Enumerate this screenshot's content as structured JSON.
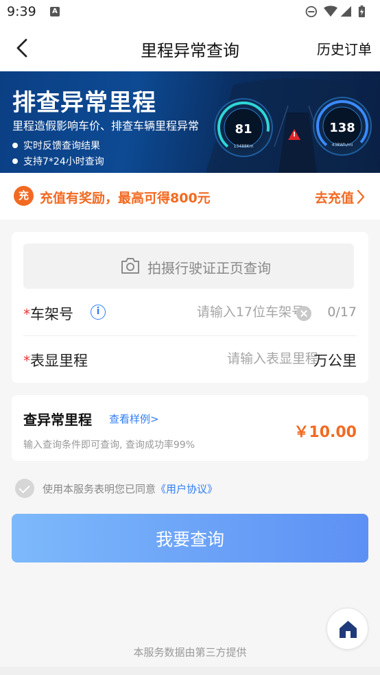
{
  "status_bar": {
    "time": "9:39",
    "notif_letter": "A"
  },
  "nav": {
    "title": "里程异常查询",
    "right_label": "历史订单"
  },
  "banner": {
    "title": "排查异常里程",
    "subtitle": "里程造假影响车价、排查车辆里程异常",
    "bullets": [
      "实时反馈查询结果",
      "支持7*24小时查询"
    ],
    "gauge_left": {
      "value": "81",
      "sub": "13488Km"
    },
    "gauge_right": {
      "value": "138",
      "sub": "438Wh/mi"
    }
  },
  "promo": {
    "icon_text": "充",
    "text": "充值有奖励，最高可得800元",
    "link": "去充值"
  },
  "form": {
    "photo_button": "拍摄行驶证正页查询",
    "vin": {
      "required_mark": "*",
      "label": "车架号",
      "placeholder": "请输入17位车架号",
      "value": "",
      "counter": "0/17"
    },
    "mileage": {
      "required_mark": "*",
      "label": "表显里程",
      "placeholder": "请输入表显里程",
      "value": "",
      "unit": "万公里"
    }
  },
  "product": {
    "name": "查异常里程",
    "sample_link": "查看样例>",
    "description": "输入查询条件即可查询, 查询成功率99%",
    "price": "￥10.00"
  },
  "agreement": {
    "prefix": "使用本服务表明您已同意",
    "link": "《用户协议》"
  },
  "submit_label": "我要查询",
  "footer": "本服务数据由第三方提供",
  "colors": {
    "accent_orange": "#f26a22",
    "link_blue": "#2f7df6",
    "button_start": "#7db9fb",
    "button_end": "#5d90f4"
  }
}
